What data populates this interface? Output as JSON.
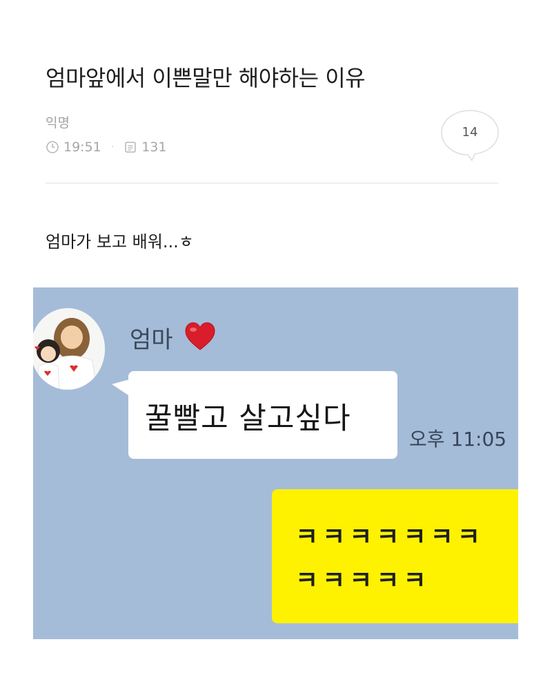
{
  "post": {
    "title": "엄마앞에서 이쁜말만 해야하는 이유",
    "author": "익명",
    "time": "19:51",
    "separator": "·",
    "views": "131",
    "comment_count": "14",
    "body": "엄마가 보고 배워...ㅎ"
  },
  "chat": {
    "background_color": "#a5bcd8",
    "sender_name": "엄마",
    "incoming_message": "꿀빨고 살고싶다",
    "incoming_time": "오후 11:05",
    "outgoing_lines": [
      "ㅋㅋㅋㅋㅋㅋㅋ",
      "ㅋㅋㅋㅋㅋ"
    ],
    "outgoing_bubble_color": "#fef200",
    "icons": [
      "heart-icon",
      "avatar"
    ]
  },
  "icons": {
    "time": "clock-icon",
    "views": "views-icon",
    "comments": "speech-bubble-icon"
  }
}
